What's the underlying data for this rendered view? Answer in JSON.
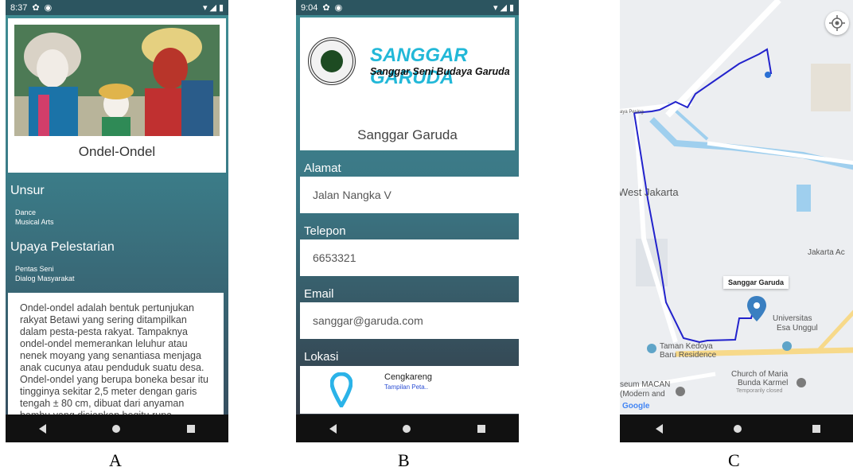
{
  "screenA": {
    "status": {
      "time": "8:37"
    },
    "title": "Ondel-Ondel",
    "section_unsur": "Unsur",
    "unsur_items": [
      "Dance",
      "Musical Arts"
    ],
    "section_upaya": "Upaya Pelestarian",
    "upaya_items": [
      "Pentas Seni",
      "Dialog Masyarakat"
    ],
    "description": "Ondel-ondel adalah bentuk pertunjukan rakyat Betawi yang sering ditampilkan dalam pesta-pesta rakyat. Tampaknya ondel-ondel memerankan leluhur atau nenek moyang yang senantiasa menjaga anak cucunya atau penduduk suatu desa. Ondel-ondel yang berupa boneka besar itu tingginya sekitar 2,5 meter dengan garis tengah ± 80 cm, dibuat dari anyaman bambu yang disiapkan begitu rupa",
    "caption": "A"
  },
  "screenB": {
    "status": {
      "time": "9:04"
    },
    "brand": "SANGGAR GARUDA",
    "brand_sub": "Sanggar Seni Budaya Garuda",
    "logo_text": "Sanggar Garuda",
    "name": "Sanggar Garuda",
    "alamat_label": "Alamat",
    "alamat_value": "Jalan Nangka V",
    "telepon_label": "Telepon",
    "telepon_value": "6653321",
    "email_label": "Email",
    "email_value": "sanggar@garuda.com",
    "lokasi_label": "Lokasi",
    "lokasi_place": "Cengkareng",
    "lokasi_link": "Tampilan Peta..",
    "caption": "B"
  },
  "screenC": {
    "labels": {
      "west_jakarta": "West Jakarta",
      "jakarta_ac": "Jakarta Ac",
      "universitas": "Universitas",
      "esa_unggul": "Esa Unggul",
      "taman": "Taman Kedoya",
      "taman2": "Baru Residence",
      "church": "Church of Maria",
      "church2": "Bunda Karmel",
      "closed": "Temporarily closed",
      "museum": "seum MACAN",
      "museum2": "(Modern and",
      "raya": "aya Pesing",
      "google": "Google"
    },
    "marker_label": "Sanggar Garuda",
    "caption": "C"
  },
  "colors": {
    "accent": "#22b8d8",
    "route": "#2222cc",
    "pin": "#3a7fc1"
  }
}
